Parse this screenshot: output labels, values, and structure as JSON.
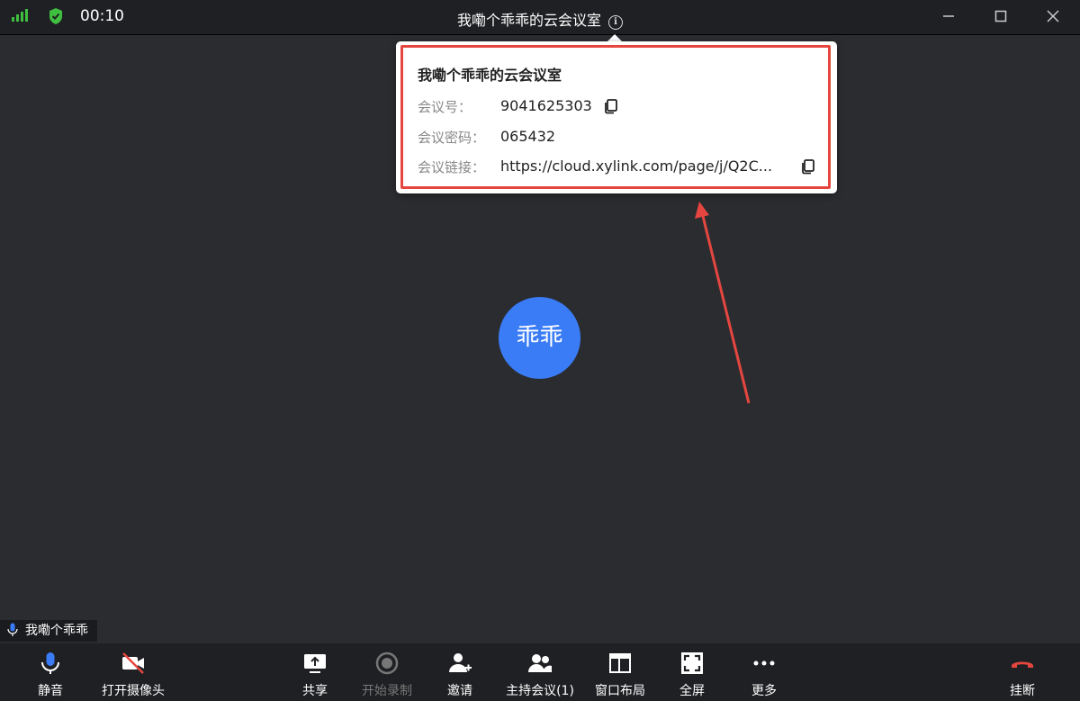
{
  "titlebar": {
    "timer": "00:10",
    "title": "我嘞个乖乖的云会议室",
    "info_glyph": "i"
  },
  "popover": {
    "title": "我嘞个乖乖的云会议室",
    "rows": [
      {
        "label": "会议号：",
        "value": "9041625303"
      },
      {
        "label": "会议密码：",
        "value": "065432"
      },
      {
        "label": "会议链接：",
        "value": "https://cloud.xylink.com/page/j/Q2C..."
      }
    ]
  },
  "avatar": {
    "text": "乖乖",
    "color": "#3a7cf6"
  },
  "participant": {
    "name": "我嘞个乖乖"
  },
  "toolbar": {
    "mute": "静音",
    "camera": "打开摄像头",
    "share": "共享",
    "record": "开始录制",
    "invite": "邀请",
    "host": "主持会议(1)",
    "layout": "窗口布局",
    "fullscreen": "全屏",
    "more": "更多",
    "hangup": "挂断"
  },
  "colors": {
    "accent": "#3a7cf6",
    "highlight": "#e5463f",
    "signal": "#3fbf3f",
    "hangup": "#e5463f"
  }
}
